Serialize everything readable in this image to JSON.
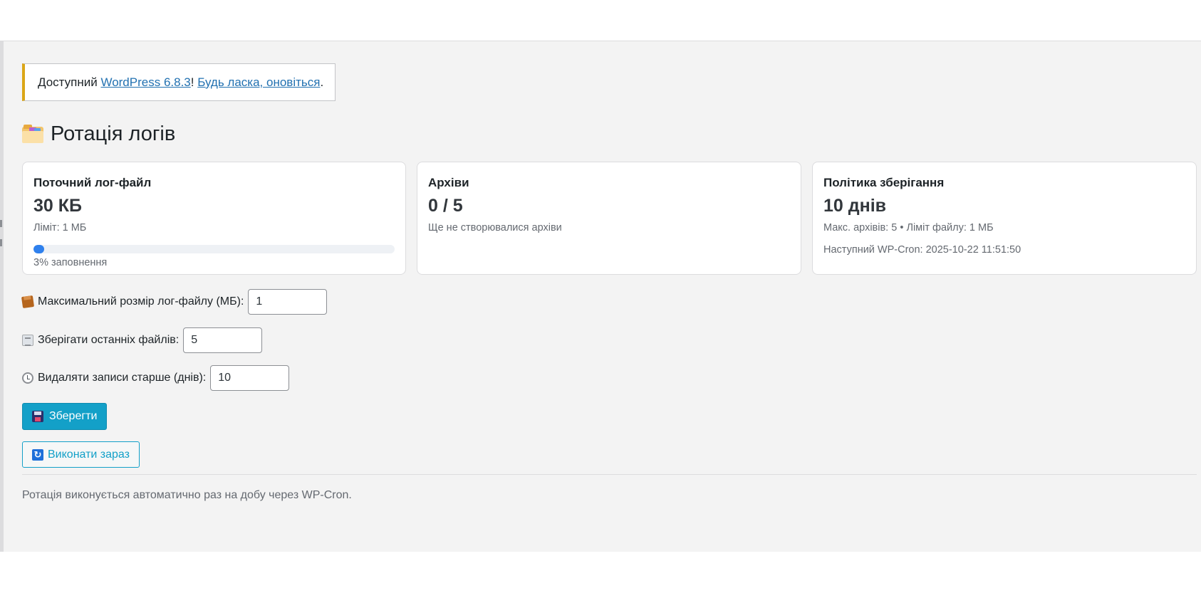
{
  "notice": {
    "prefix": "Доступний ",
    "version_link": "WordPress 6.8.3",
    "middle": "! ",
    "update_link": "Будь ласка, оновіться",
    "suffix": "."
  },
  "page": {
    "icon": "folder-icon",
    "title": "Ротація логів"
  },
  "cards": {
    "current_log": {
      "title": "Поточний лог-файл",
      "value": "30 КБ",
      "limit": "Ліміт: 1 МБ",
      "fill_percent": 3,
      "progress_label": "3% заповнення"
    },
    "archives": {
      "title": "Архіви",
      "value": "0 / 5",
      "note": "Ще не створювалися архіви"
    },
    "retention": {
      "title": "Політика зберігання",
      "value": "10 днів",
      "details": "Макс. архівів: 5 • Ліміт файлу: 1 МБ",
      "next_cron": "Наступний WP-Cron: 2025-10-22 11:51:50"
    }
  },
  "form": {
    "max_size": {
      "icon": "package-icon",
      "label": "Максимальний розмір лог-файлу (МБ):",
      "value": "1"
    },
    "keep_files": {
      "icon": "document-icon",
      "label": "Зберігати останніх файлів:",
      "value": "5"
    },
    "delete_older": {
      "icon": "clock-icon",
      "label": "Видаляти записи старше (днів):",
      "value": "10"
    }
  },
  "buttons": {
    "save": {
      "icon": "floppy-disk-icon",
      "label": "Зберегти"
    },
    "run_now": {
      "icon": "refresh-icon",
      "label": "Виконати зараз"
    }
  },
  "footnote": "Ротація виконується автоматично раз на добу через WP-Cron.",
  "colors": {
    "accent": "#13a0c8",
    "notice_border": "#dba617",
    "progress": "#2f80ed",
    "link": "#2271b1"
  }
}
